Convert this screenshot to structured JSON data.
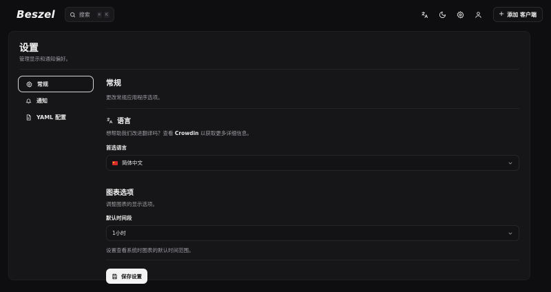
{
  "header": {
    "logo": "Beszel",
    "search_placeholder": "搜索",
    "search_shortcut": [
      "⌘",
      "K"
    ],
    "add_button_label": "添加 客户端"
  },
  "page": {
    "title": "设置",
    "subtitle": "管理显示和通知偏好。"
  },
  "sidebar": {
    "items": [
      {
        "label": "常规",
        "icon": "gear-icon",
        "active": true
      },
      {
        "label": "通知",
        "icon": "bell-icon",
        "active": false
      },
      {
        "label": "YAML 配置",
        "icon": "file-icon",
        "active": false
      }
    ]
  },
  "general": {
    "title": "常规",
    "description": "更改常规应用程序选项。"
  },
  "language": {
    "title": "语言",
    "description_prefix": "想帮助我们改进翻译吗？查看 ",
    "description_link": "Crowdin",
    "description_suffix": " 以获取更多详细信息。",
    "field_label": "首选语言",
    "selected": "简体中文"
  },
  "chart_options": {
    "title": "图表选项",
    "description": "调整图表的显示选项。",
    "field_label": "默认时间段",
    "selected": "1小时",
    "hint": "设置查看系统时图表的默认时间范围。"
  },
  "save_button_label": "保存设置",
  "colors": {
    "background": "#0e0e10",
    "card": "#161618",
    "accent_button": "#f3f3f3",
    "flag_red": "#d62b2b"
  }
}
